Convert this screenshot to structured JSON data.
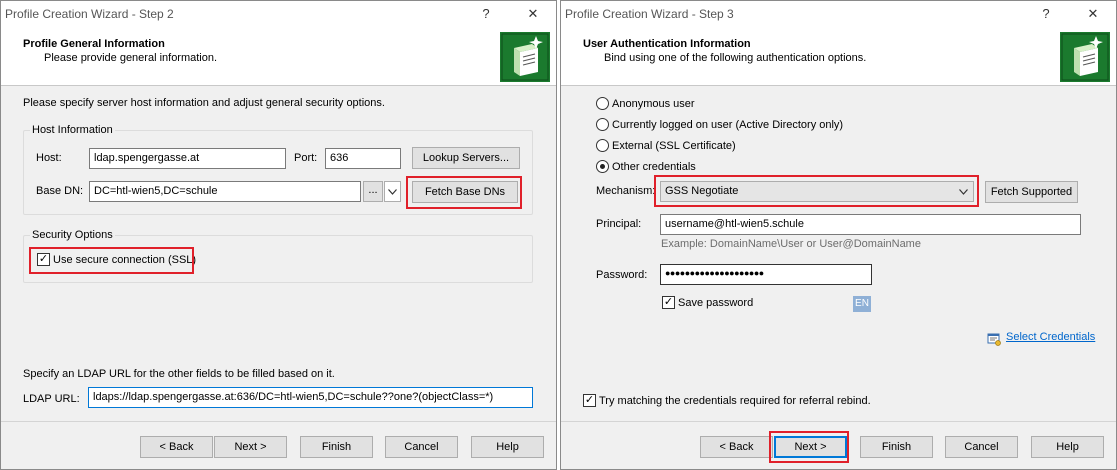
{
  "step2": {
    "window_title": "Profile Creation Wizard - Step 2",
    "help_glyph": "?",
    "close_glyph": "✕",
    "header_title": "Profile General Information",
    "header_subtitle": "Please provide general information.",
    "intro": "Please specify server host information and adjust general security options.",
    "host_group_title": "Host Information",
    "host_label": "Host:",
    "host_value": "ldap.spengergasse.at",
    "port_label": "Port:",
    "port_value": "636",
    "lookup_button": "Lookup Servers...",
    "base_dn_label": "Base DN:",
    "base_dn_value": "DC=htl-wien5,DC=schule",
    "browse_button": "...",
    "fetch_base_dns_button": "Fetch Base DNs",
    "security_group_title": "Security Options",
    "ssl_label": "Use secure connection (SSL)",
    "ssl_checked": true,
    "ldap_url_intro": "Specify an LDAP URL for the other fields to be filled based on it.",
    "ldap_url_label": "LDAP URL:",
    "ldap_url_value": "ldaps://ldap.spengergasse.at:636/DC=htl-wien5,DC=schule??one?(objectClass=*)",
    "buttons": {
      "back": "< Back",
      "next": "Next >",
      "finish": "Finish",
      "cancel": "Cancel",
      "help": "Help"
    }
  },
  "step3": {
    "window_title": "Profile Creation Wizard - Step 3",
    "help_glyph": "?",
    "close_glyph": "✕",
    "header_title": "User Authentication Information",
    "header_subtitle": "Bind using one of the following authentication options.",
    "auth_options": [
      {
        "label": "Anonymous user",
        "selected": false
      },
      {
        "label": "Currently logged on user (Active Directory only)",
        "selected": false
      },
      {
        "label": "External (SSL Certificate)",
        "selected": false
      },
      {
        "label": "Other credentials",
        "selected": true
      }
    ],
    "mechanism_label": "Mechanism:",
    "mechanism_value": "GSS Negotiate",
    "fetch_supported_button": "Fetch Supported",
    "principal_label": "Principal:",
    "principal_value": "username@htl-wien5.schule",
    "principal_hint": "Example: DomainName\\User or User@DomainName",
    "password_label": "Password:",
    "password_value": "●●●●●●●●●●●●●●●●●●●●",
    "save_password_label": "Save password",
    "save_password_checked": true,
    "lang_badge": "EN",
    "select_credentials_link": "Select Credentials",
    "referral_label": "Try matching the credentials required for referral rebind.",
    "referral_checked": true,
    "buttons": {
      "back": "< Back",
      "next": "Next >",
      "finish": "Finish",
      "cancel": "Cancel",
      "help": "Help"
    }
  },
  "colors": {
    "highlight_box": "#e0202a",
    "link": "#0066cc",
    "default_button_border": "#0078d7"
  }
}
